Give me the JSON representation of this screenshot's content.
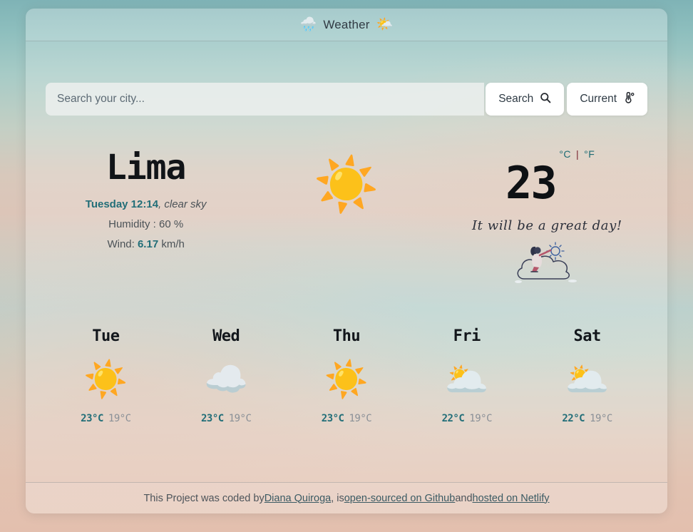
{
  "header": {
    "title": "Weather",
    "left_emoji": "🌧️",
    "right_emoji": "🌤️",
    "left_icon_name": "rain-cloud-icon",
    "right_icon_name": "sun-behind-cloud-icon"
  },
  "search": {
    "placeholder": "Search your city...",
    "value": "",
    "search_label": "Search",
    "search_icon": "🔍",
    "current_label": "Current",
    "current_icon": "🌡"
  },
  "current": {
    "city": "Lima",
    "day_time": "Tuesday 12:14",
    "description": ", clear sky",
    "humidity_label": "Humidity : ",
    "humidity_value": "60 %",
    "wind_label": "Wind: ",
    "wind_value": "6.17",
    "wind_unit": " km/h",
    "icon": "☀️",
    "icon_name": "sun-icon",
    "temperature": "23",
    "unit_celsius": "°C",
    "unit_separator": "|",
    "unit_fahrenheit": "°F",
    "mood_message": "It will be a great day!"
  },
  "forecast": [
    {
      "day": "Tue",
      "icon": "☀️",
      "icon_name": "sun-icon",
      "max": "23°C",
      "min": "19°C"
    },
    {
      "day": "Wed",
      "icon": "☁️",
      "icon_name": "cloud-icon",
      "max": "23°C",
      "min": "19°C"
    },
    {
      "day": "Thu",
      "icon": "☀️",
      "icon_name": "sun-icon",
      "max": "23°C",
      "min": "19°C"
    },
    {
      "day": "Fri",
      "icon": "🌥️",
      "icon_name": "sun-behind-cloud-icon",
      "max": "22°C",
      "min": "19°C"
    },
    {
      "day": "Sat",
      "icon": "🌥️",
      "icon_name": "sun-behind-cloud-icon",
      "max": "22°C",
      "min": "19°C"
    }
  ],
  "footer": {
    "text_1": "This Project was coded by ",
    "link_author": "Diana Quiroga",
    "text_2": " , is ",
    "link_source": "open-sourced on Github",
    "text_3": " and ",
    "link_host": "hosted on Netlify"
  },
  "colors": {
    "accent_teal": "#226e78",
    "text_dark": "#111418",
    "muted": "#8a9097",
    "separator_red": "#7a2430"
  }
}
